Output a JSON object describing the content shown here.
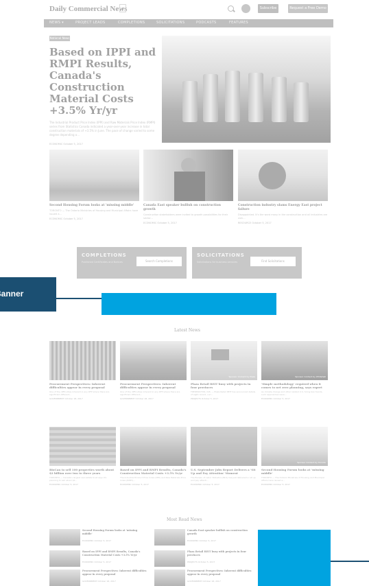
{
  "header": {
    "logo": "Daily Commercial News",
    "lang": "▾",
    "subscribe": "Subscribe",
    "free_trial": "Request a Free Demo"
  },
  "nav": [
    "NEWS ▾",
    "PROJECT LEADS",
    "COMPLETIONS",
    "SOLICITATIONS",
    "PODCASTS",
    "FEATURES"
  ],
  "hero": {
    "tag": "National News",
    "title": "Based on IPPI and RMPI Results, Canada's Construction Material Costs +3.5% Yr/yr",
    "summary": "The Industrial Product Price Index (IPPI) and Raw Materials Price Index (RMPI) series from Statistics Canada indicated a year-over-year increase in total construction materials of +3.5% in June. The pace of change varied to some degree depending o...",
    "meta": "ECONOMIC   October 5, 2017"
  },
  "top_cards": [
    {
      "title": "Second Housing Forum looks at 'missing middle'",
      "summary": "TORONTO — The Ontario Ministries of Housing and Municipal Affairs have issued a...",
      "meta": "ECONOMIC   October 5, 2017"
    },
    {
      "title": "Canada East speaker bullish on construction growth",
      "summary": "Construction stakeholders were invited to growth possibilities for their sector...",
      "meta": "ECONOMIC   October 5, 2017"
    },
    {
      "title": "Construction industry slams Energy East project failure",
      "summary": "Disappointed. It's the word many in the construction and oil industries are usin...",
      "meta": "RESOURCE   October 5, 2017"
    }
  ],
  "completions": {
    "heading": "COMPLETIONS",
    "desc": "Published Certificates and Notices",
    "button": "Search Completions"
  },
  "solicitations": {
    "heading": "SOLICITATIONS",
    "desc": "Solicitations for business services",
    "button": "Find Solicitations"
  },
  "callout": {
    "label": "Banner"
  },
  "latest": {
    "heading": "Latest News",
    "cards": [
      {
        "title": "Procurement Perspectives: Inherent difficulties appear in every proposal",
        "summary": "One of the difficulties inherent in any RFP where there are significant different...",
        "meta": "GOVERNMENT   October 18, 2017",
        "caption": ""
      },
      {
        "title": "Procurement Perspectives: Inherent difficulties appear in every proposal",
        "summary": "One of the difficulties inherent in any RFP where there are significant different...",
        "meta": "GOVERNMENT   October 18, 2017",
        "caption": ""
      },
      {
        "title": "Plaza Retail REIT busy with projects in four provinces",
        "summary": "FREDERICTON, N.B. — Plaza Retail REIT has announced details of eight recent, curr...",
        "meta": "PROJECTS   October 5, 2017",
        "caption": "Sponsor Content by Plaza"
      },
      {
        "title": "'Simple methodology' required when it comes to net zero planning, says expert",
        "summary": "As climate change and other related U.S. hiring ban trends, such approaches were...",
        "meta": "ECONOMIC   October 5, 2017",
        "caption": "Sponsor Content by Whitehall"
      },
      {
        "title": "BioCan to sell 100 properties worth about $2 billion over two to three years",
        "summary": "TORONTO — Canada's largest real estate trust says it's planning to sell about $2...",
        "meta": "ECONOMIC   October 5, 2017",
        "caption": ""
      },
      {
        "title": "Based on IPPI and RMPI Results, Canada's Construction Material Costs +3.5% Yr/yr",
        "summary": "The Industrial Product Price Index (IPPI) and Raw Materials Price Index (RMPI)...",
        "meta": "ECONOMIC   October 5, 2017",
        "caption": ""
      },
      {
        "title": "U.S. September Jobs Report Delivers a 'Sit Up and Pay Attention' Moment",
        "summary": "The Bureau of Labor Statistics (BLS) has just delivered a 'sit up and pay attenti...",
        "meta": "ECONOMIC   October 5, 2017",
        "caption": ""
      },
      {
        "title": "Second Housing Forum looks at 'missing middle'",
        "summary": "TORONTO — The Ontario Ministries of Housing and Municipal Affairs have issued a...",
        "meta": "ECONOMIC   October 5, 2017",
        "caption": "Sponsor Content by Toronto"
      }
    ]
  },
  "most_read": {
    "heading": "Most Read News",
    "items": [
      {
        "title": "Second Housing Forum looks at 'missing middle'",
        "meta": "ECONOMIC   October 5, 2017"
      },
      {
        "title": "Canada East speaker bullish on construction growth",
        "meta": "ECONOMIC   October 5, 2017"
      },
      {
        "title": "Based on IPPI and RMPI Results, Canada's Construction Material Costs +3.5% Yr/yr",
        "meta": "ECONOMIC   October 5, 2017"
      },
      {
        "title": "Plaza Retail REIT busy with projects in four provinces",
        "meta": "PROJECTS   October 5, 2017"
      },
      {
        "title": "Procurement Perspectives: Inherent difficulties appear in every proposal",
        "meta": "GOVERNMENT   October 18, 2017"
      },
      {
        "title": "Procurement Perspectives: Inherent difficulties appear in every proposal",
        "meta": "GOVERNMENT   October 18, 2017"
      }
    ]
  },
  "colors": {
    "banner": "#00a3e0",
    "callout": "#1b4f72",
    "nav": "#8a8a8a"
  }
}
